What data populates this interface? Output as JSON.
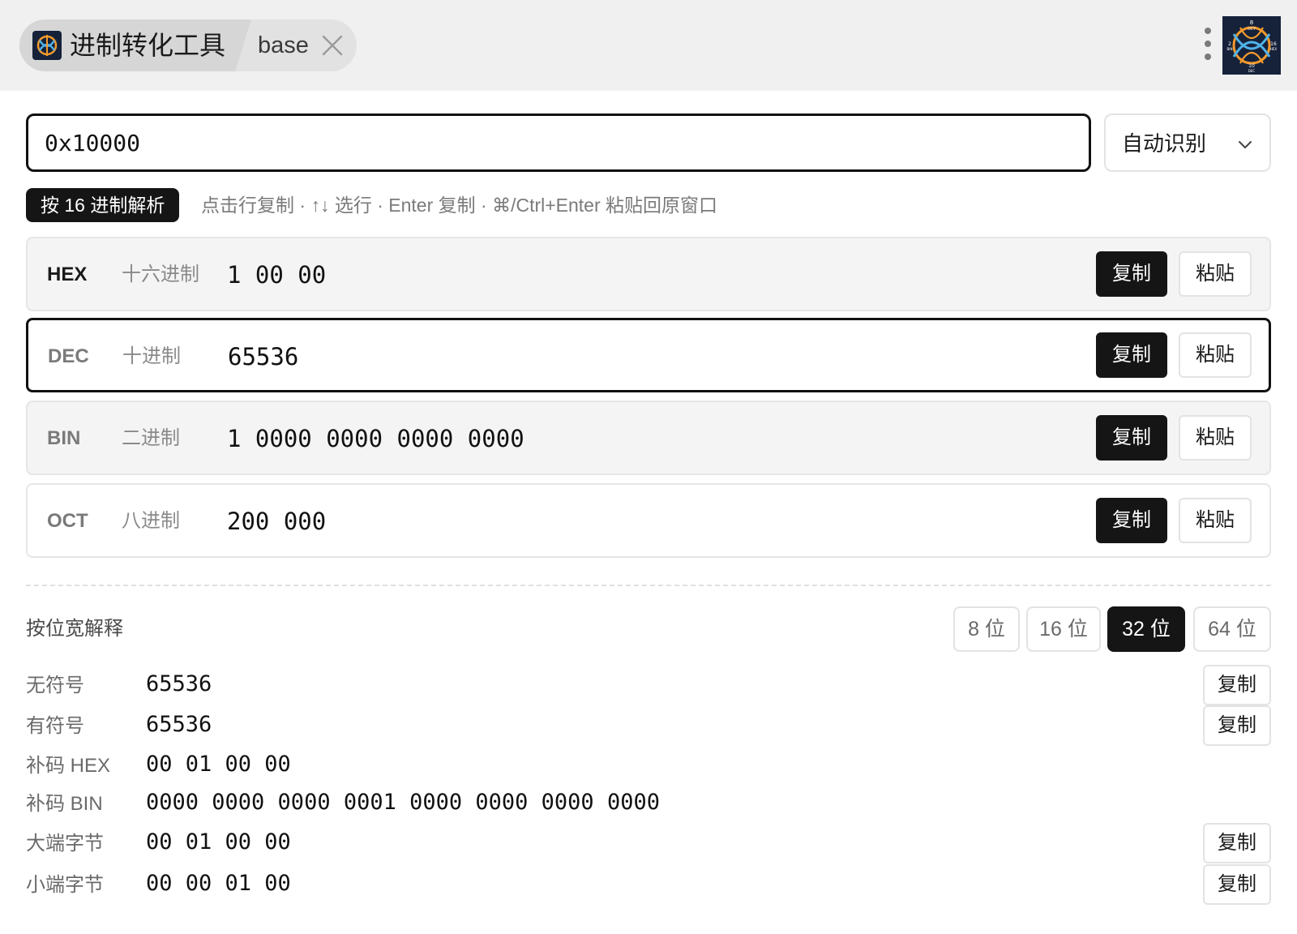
{
  "header": {
    "tab_title": "进制转化工具",
    "tab_sub": "base",
    "icons": {
      "app": "app-logo-icon",
      "close": "close-icon",
      "menu": "more-vertical-icon",
      "avatar": "plugin-logo-icon"
    },
    "avatar_labels": {
      "top": "8",
      "top2": "OCT",
      "left": "2",
      "left2": "BIN",
      "right": "16",
      "right2": "HEX",
      "bottom": "10",
      "bottom2": "DEC"
    }
  },
  "input": {
    "value": "0x10000",
    "mode_label": "自动识别"
  },
  "hint": {
    "badge": "按 16 进制解析",
    "text": "点击行复制 · ↑↓ 选行 · Enter 复制 · ⌘/Ctrl+Enter 粘贴回原窗口"
  },
  "rows": [
    {
      "code": "HEX",
      "name": "十六进制",
      "value": "1 00 00",
      "copy_label": "复制",
      "paste_label": "粘贴"
    },
    {
      "code": "DEC",
      "name": "十进制",
      "value": "65536",
      "copy_label": "复制",
      "paste_label": "粘贴"
    },
    {
      "code": "BIN",
      "name": "二进制",
      "value": "1 0000 0000 0000 0000",
      "copy_label": "复制",
      "paste_label": "粘贴"
    },
    {
      "code": "OCT",
      "name": "八进制",
      "value": "200 000",
      "copy_label": "复制",
      "paste_label": "粘贴"
    }
  ],
  "bitwidth": {
    "title": "按位宽解释",
    "options": [
      "8 位",
      "16 位",
      "32 位",
      "64 位"
    ],
    "selected": "32 位",
    "items": [
      {
        "label": "无符号",
        "value": "65536",
        "copy_label": "复制"
      },
      {
        "label": "有符号",
        "value": "65536",
        "copy_label": "复制"
      },
      {
        "label": "补码 HEX",
        "value": "00 01 00 00"
      },
      {
        "label": "补码 BIN",
        "value": "0000 0000 0000 0001 0000 0000 0000 0000"
      },
      {
        "label": "大端字节",
        "value": "00 01 00 00",
        "copy_label": "复制"
      },
      {
        "label": "小端字节",
        "value": "00 00 01 00",
        "copy_label": "复制"
      }
    ]
  },
  "colors": {
    "accent": "#151515",
    "background": "#ffffff",
    "topbar": "#f0f0f0",
    "logo_orange": "#f39a2b",
    "logo_blue": "#4fb3e8"
  }
}
